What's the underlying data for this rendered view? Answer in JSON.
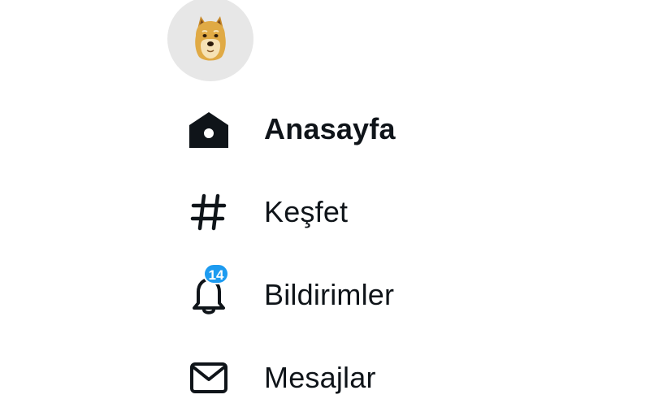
{
  "profile": {
    "avatar_icon": "doge-avatar-icon"
  },
  "nav": {
    "items": [
      {
        "label": "Anasayfa",
        "icon": "home-icon",
        "active": true
      },
      {
        "label": "Keşfet",
        "icon": "hashtag-icon",
        "active": false
      },
      {
        "label": "Bildirimler",
        "icon": "bell-icon",
        "active": false,
        "badge": "14"
      },
      {
        "label": "Mesajlar",
        "icon": "envelope-icon",
        "active": false
      }
    ]
  },
  "colors": {
    "badge": "#1d9bf0",
    "text": "#0f1419",
    "avatar_bg": "#e7e7e7"
  }
}
